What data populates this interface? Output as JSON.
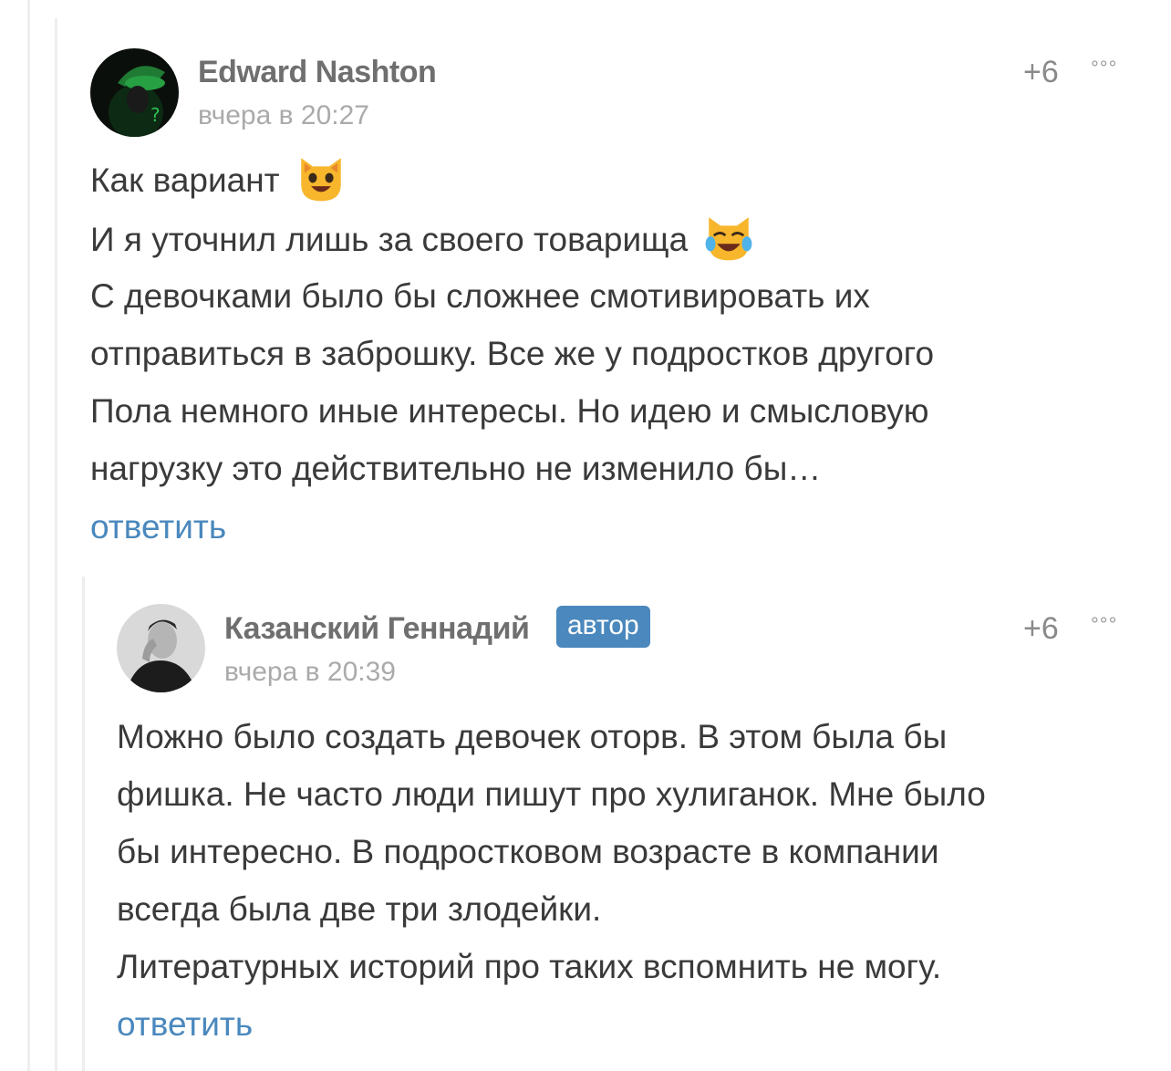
{
  "comments": [
    {
      "author": "Edward Nashton",
      "date": "вчера в 20:27",
      "rating": "+6",
      "more_icon": "more-dots-icon",
      "avatar_icon": "riddler-avatar",
      "lines": [
        "Как вариант",
        "И я уточнил лишь за своего товарища",
        "С девочками было бы сложнее смотивировать их",
        "отправиться в заброшку. Все же у подростков другого",
        "Пола немного иные интересы. Но идею и смысловую",
        "нагрузку это действительно не изменило бы…"
      ],
      "emojis": [
        "smiling-cat-emoji",
        "crying-laughing-cat-emoji"
      ],
      "reply_label": "ответить"
    },
    {
      "author": "Казанский Геннадий",
      "badge": "автор",
      "date": "вчера в 20:39",
      "rating": "+6",
      "more_icon": "more-dots-icon",
      "avatar_icon": "author-photo-avatar",
      "lines": [
        "Можно было создать девочек оторв. В этом была бы",
        "фишка. Не часто люди пишут про хулиганок. Мне было",
        "бы интересно. В подростковом возрасте в компании",
        "всегда была две три злодейки.",
        "Литературных историй про таких вспомнить не могу."
      ],
      "reply_label": "ответить"
    }
  ],
  "colors": {
    "accent": "#4a88bd",
    "author": "#6f6f6f",
    "meta": "#aaaaaa",
    "text": "#3a3a3a",
    "thread_line": "#eeeeee"
  }
}
